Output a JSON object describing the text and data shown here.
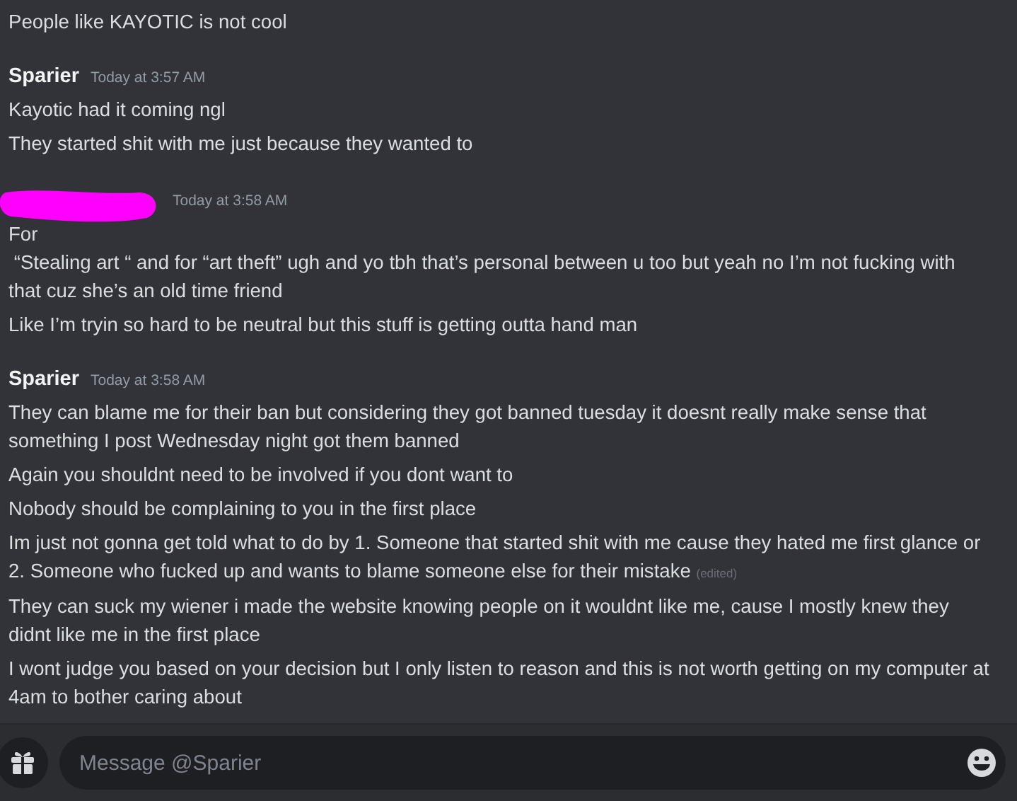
{
  "messages": [
    {
      "kind": "continuation",
      "lines": [
        {
          "text": "People like KAYOTIC is not cool"
        }
      ]
    },
    {
      "kind": "named",
      "author": "Sparier",
      "time": "Today at 3:57 AM",
      "lines": [
        {
          "text": "Kayotic had it coming ngl"
        },
        {
          "text": "They started shit with me just because they wanted to"
        }
      ]
    },
    {
      "kind": "redacted",
      "time": "Today at 3:58 AM",
      "lines": [
        {
          "text": "For\n “Stealing art “ and for “art theft” ugh and yo tbh that’s personal between u too but yeah no I’m not fucking with that cuz she’s an old time friend"
        },
        {
          "text": "Like I’m tryin so hard to be neutral but this stuff is getting outta hand man"
        }
      ]
    },
    {
      "kind": "named",
      "author": "Sparier",
      "time": "Today at 3:58 AM",
      "lines": [
        {
          "text": "They can blame me for their ban but considering they got banned tuesday it doesnt really make sense that something I post Wednesday night got them banned"
        },
        {
          "text": "Again you shouldnt need to be involved if you dont want to"
        },
        {
          "text": "Nobody should be complaining to you in the first place"
        },
        {
          "text": "Im just not gonna get told what to do by 1. Someone that started shit with me cause they hated me first glance or 2. Someone who fucked up and wants to blame someone else for their mistake",
          "edited_label": "(edited)"
        },
        {
          "text": "They can suck my wiener i made the website knowing people on it wouldnt like me, cause I mostly knew they didnt like me in the first place"
        },
        {
          "text": "I wont judge you based on your decision but I only listen to reason and this is not worth getting on my computer at 4am to bother caring about"
        }
      ]
    }
  ],
  "composer": {
    "placeholder": "Message @Sparier"
  }
}
